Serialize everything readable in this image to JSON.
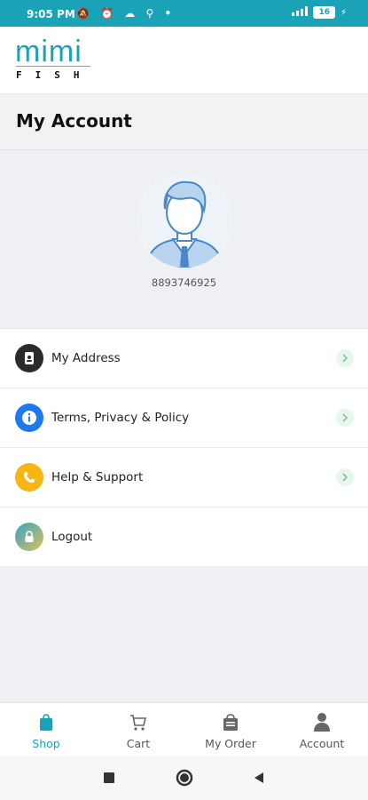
{
  "status_bar": {
    "time": "9:05 PM",
    "battery": "16"
  },
  "brand": {
    "logo_main": "mimi",
    "logo_sub": "FISH",
    "accent_color": "#1aa3b6"
  },
  "page": {
    "title": "My Account"
  },
  "profile": {
    "phone": "8893746925"
  },
  "menu": [
    {
      "label": "My Address",
      "icon": "address-book-icon",
      "color": "#2b2b2b",
      "has_chevron": true
    },
    {
      "label": "Terms, Privacy & Policy",
      "icon": "info-icon",
      "color": "#1e78ee",
      "has_chevron": true
    },
    {
      "label": "Help & Support",
      "icon": "phone-icon",
      "color": "#f6b512",
      "has_chevron": true
    },
    {
      "label": "Logout",
      "icon": "lock-icon",
      "color": "#5aa88d",
      "has_chevron": false
    }
  ],
  "bottom_nav": [
    {
      "label": "Shop",
      "icon": "shopping-bag-icon",
      "active": true
    },
    {
      "label": "Cart",
      "icon": "cart-icon",
      "active": false
    },
    {
      "label": "My Order",
      "icon": "order-bag-icon",
      "active": false
    },
    {
      "label": "Account",
      "icon": "user-icon",
      "active": false
    }
  ]
}
